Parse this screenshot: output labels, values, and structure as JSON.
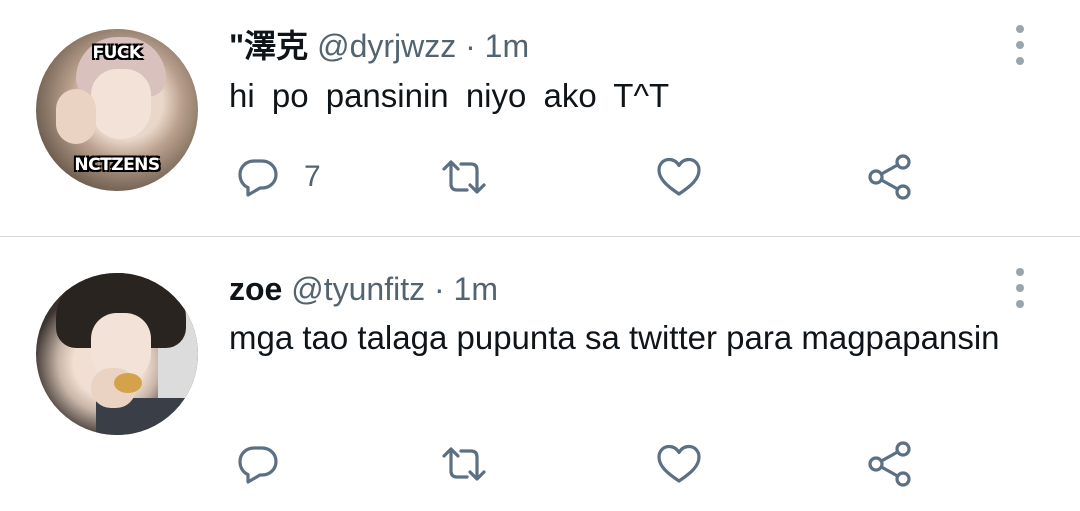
{
  "tweets": [
    {
      "avatar": {
        "top_text": "FUCK",
        "bottom_text": "NCTZENS"
      },
      "name": "ʺ澤克",
      "handle": "@dyrjwzz",
      "separator": "·",
      "time": "1m",
      "text": "hi po pansinin niyo ako T^T",
      "reply_count": "7"
    },
    {
      "name": "zoe",
      "handle": "@tyunfitz",
      "separator": "·",
      "time": "1m",
      "text": "mga tao talaga pupunta sa twitter para magpapansin",
      "reply_count": ""
    }
  ],
  "icons": [
    "reply-icon",
    "retweet-icon",
    "like-icon",
    "share-icon",
    "more-icon"
  ],
  "colors": {
    "text": "#0f1419",
    "secondary": "#536471",
    "icon": "#5b7083",
    "divider": "#d6d9db"
  }
}
